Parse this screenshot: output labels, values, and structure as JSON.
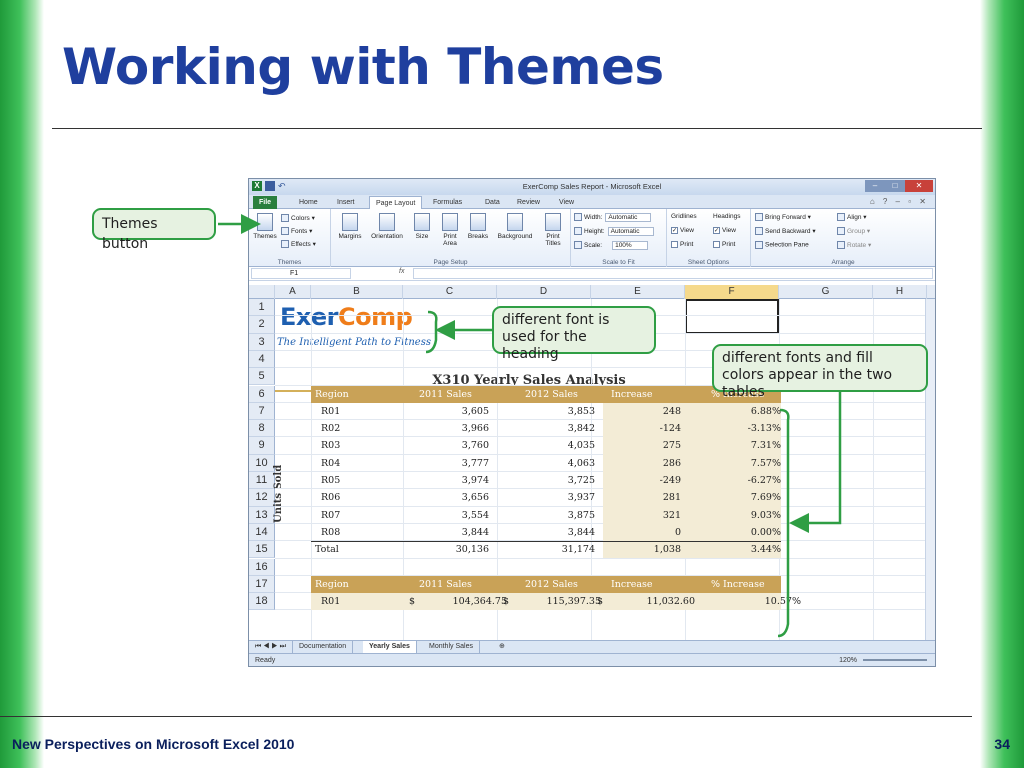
{
  "slide": {
    "title": "Working with Themes",
    "footer_left": "New Perspectives on Microsoft Excel 2010",
    "page_number": "34"
  },
  "window": {
    "title": "ExerComp Sales Report - Microsoft Excel"
  },
  "ribbon_tabs": [
    "File",
    "Home",
    "Insert",
    "Page Layout",
    "Formulas",
    "Data",
    "Review",
    "View"
  ],
  "ribbon": {
    "themes": {
      "button": "Themes",
      "colors": "Colors",
      "fonts": "Fonts",
      "effects": "Effects",
      "group": "Themes"
    },
    "page_setup": {
      "items": [
        "Margins",
        "Orientation",
        "Size",
        "Print Area",
        "Breaks",
        "Background",
        "Print Titles"
      ],
      "group": "Page Setup"
    },
    "scale_to_fit": {
      "width_label": "Width:",
      "width_value": "Automatic",
      "height_label": "Height:",
      "height_value": "Automatic",
      "scale_label": "Scale:",
      "scale_value": "100%",
      "group": "Scale to Fit"
    },
    "sheet_options": {
      "gridlines": "Gridlines",
      "headings": "Headings",
      "view": "View",
      "print": "Print",
      "group": "Sheet Options"
    },
    "arrange": {
      "bring_forward": "Bring Forward",
      "send_backward": "Send Backward",
      "selection_pane": "Selection Pane",
      "align": "Align",
      "group_btn": "Group",
      "rotate": "Rotate",
      "group": "Arrange"
    }
  },
  "formula_bar": {
    "name_box": "F1",
    "fx": "fx",
    "formula": ""
  },
  "columns": [
    "A",
    "B",
    "C",
    "D",
    "E",
    "F",
    "G",
    "H"
  ],
  "rows": [
    "1",
    "2",
    "3",
    "4",
    "5",
    "6",
    "7",
    "8",
    "9",
    "10",
    "11",
    "12",
    "13",
    "14",
    "15",
    "16",
    "17",
    "18"
  ],
  "sheet": {
    "logo_exer": "Exer",
    "logo_comp": "Comp",
    "tagline": "The Intelligent Path to Fitness",
    "title": "X310 Yearly Sales Analysis",
    "vertical_label": "Units Sold",
    "table1": {
      "headers": [
        "Region",
        "2011 Sales",
        "2012 Sales",
        "Increase",
        "% Increase"
      ],
      "rows": [
        [
          "R01",
          "3,605",
          "3,853",
          "248",
          "6.88%"
        ],
        [
          "R02",
          "3,966",
          "3,842",
          "-124",
          "-3.13%"
        ],
        [
          "R03",
          "3,760",
          "4,035",
          "275",
          "7.31%"
        ],
        [
          "R04",
          "3,777",
          "4,063",
          "286",
          "7.57%"
        ],
        [
          "R05",
          "3,974",
          "3,725",
          "-249",
          "-6.27%"
        ],
        [
          "R06",
          "3,656",
          "3,937",
          "281",
          "7.69%"
        ],
        [
          "R07",
          "3,554",
          "3,875",
          "321",
          "9.03%"
        ],
        [
          "R08",
          "3,844",
          "3,844",
          "0",
          "0.00%"
        ]
      ],
      "total": [
        "Total",
        "30,136",
        "31,174",
        "1,038",
        "3.44%"
      ]
    },
    "table2": {
      "headers": [
        "Region",
        "2011 Sales",
        "2012 Sales",
        "Increase",
        "% Increase"
      ],
      "row": [
        "R01",
        "$",
        "104,364.75",
        "$",
        "115,397.35",
        "$",
        "11,032.60",
        "10.57%"
      ]
    }
  },
  "sheet_tabs": [
    "Documentation",
    "Yearly Sales",
    "Monthly Sales"
  ],
  "status": {
    "ready": "Ready",
    "zoom": "120%"
  },
  "callouts": {
    "themes_button": "Themes button",
    "heading_font": "different font is used for the heading",
    "tables": "different fonts and fill colors appear in the two tables"
  }
}
